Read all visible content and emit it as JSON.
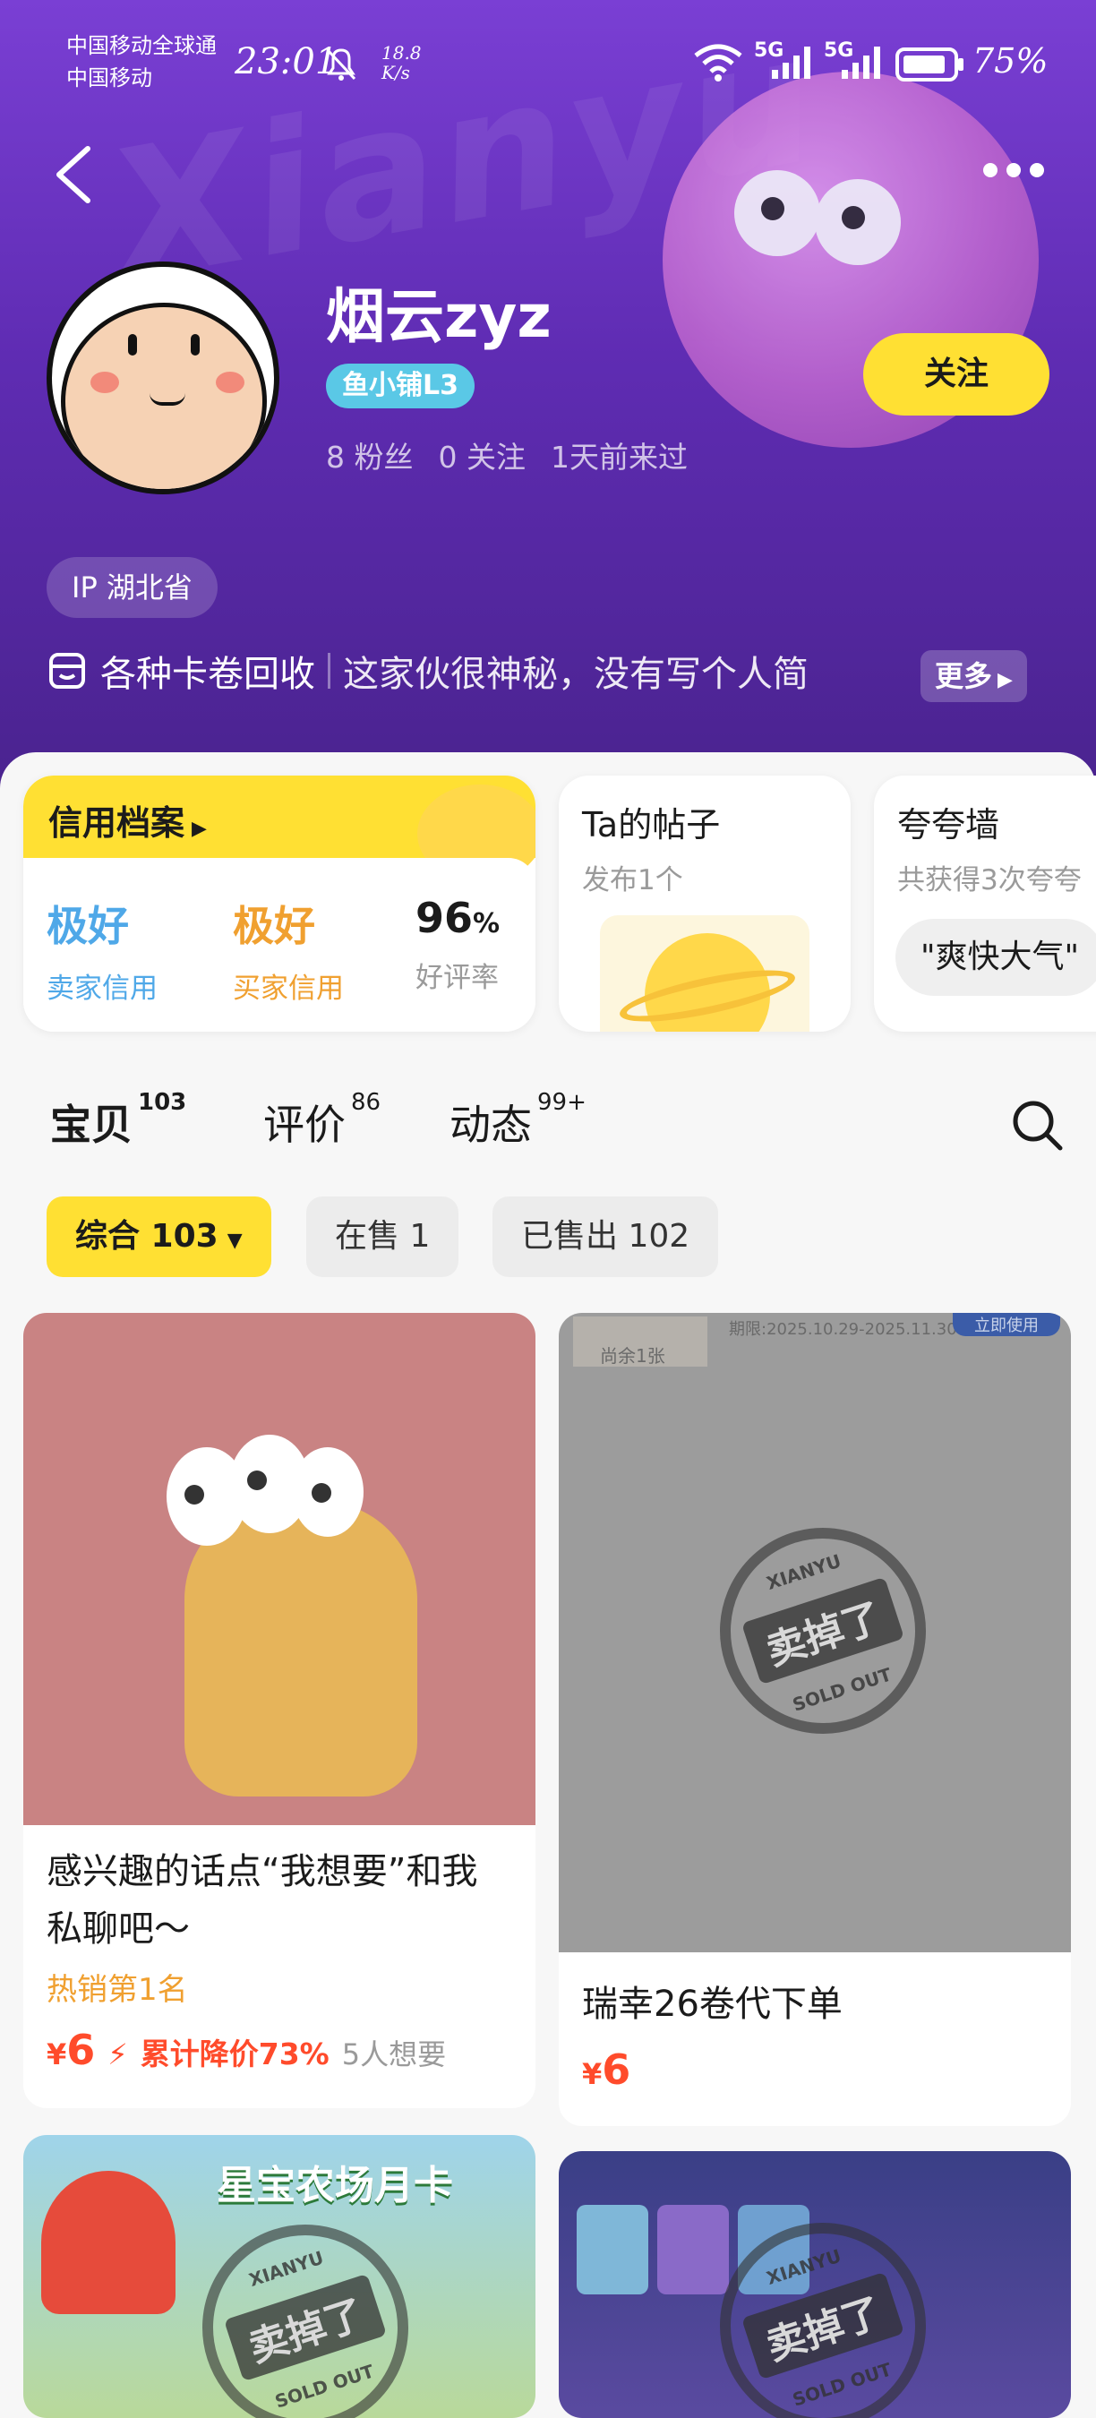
{
  "status_bar": {
    "carrier_1": "中国移动全球通",
    "carrier_2": "中国移动",
    "time": "23:01",
    "speed_value": "18.8",
    "speed_unit": "K/s",
    "net_1": "5G",
    "net_2": "5G",
    "battery": "75%"
  },
  "profile": {
    "watermark": "Xianyu",
    "username": "烟云zyz",
    "level": "鱼小铺L3",
    "fans": "8 粉丝",
    "following": "0 关注",
    "last_seen": "1天前来过",
    "follow_label": "关注",
    "ip": "IP 湖北省",
    "shop_tag": "各种卡卷回收",
    "bio": "这家伙很神秘，没有写个人简",
    "more_label": "更多"
  },
  "credit": {
    "title": "信用档案",
    "seller_rating": "极好",
    "seller_label": "卖家信用",
    "buyer_rating": "极好",
    "buyer_label": "买家信用",
    "good_rate": "96",
    "good_rate_unit": "%",
    "good_rate_label": "好评率"
  },
  "posts": {
    "title": "Ta的帖子",
    "sub": "发布1个"
  },
  "praise": {
    "title": "夸夸墙",
    "sub": "共获得3次夸夸",
    "quote": "\"爽快大气\""
  },
  "tabs": [
    {
      "label": "宝贝",
      "count": "103"
    },
    {
      "label": "评价",
      "count": "86"
    },
    {
      "label": "动态",
      "count": "99+"
    }
  ],
  "filters": {
    "all": "综合 103",
    "on_sale": "在售 1",
    "sold": "已售出 102"
  },
  "products": [
    {
      "title": "感兴趣的话点“我想要”和我私聊吧～",
      "tag": "热销第1名",
      "price_symbol": "¥",
      "price": "6",
      "discount": "累计降价73%",
      "wants": "5人想要"
    },
    {
      "title": "瑞幸26卷代下单",
      "price_symbol": "¥",
      "price": "6",
      "img_text_1": "尚余1张",
      "img_text_2": "期限:2025.10.29-2025.11.30",
      "img_btn": "立即使用"
    },
    {
      "img_title": "星宝农场月卡"
    },
    {
      "img_title": ""
    }
  ],
  "stamp": {
    "top": "XIANYU",
    "main": "卖掉了",
    "bottom": "SOLD OUT"
  },
  "colors": {
    "accent_yellow": "#ffe033",
    "price_red": "#ff4b2b",
    "header_purple": "#6a33c4",
    "seller_blue": "#4fa8e8",
    "buyer_orange": "#f0a030"
  }
}
